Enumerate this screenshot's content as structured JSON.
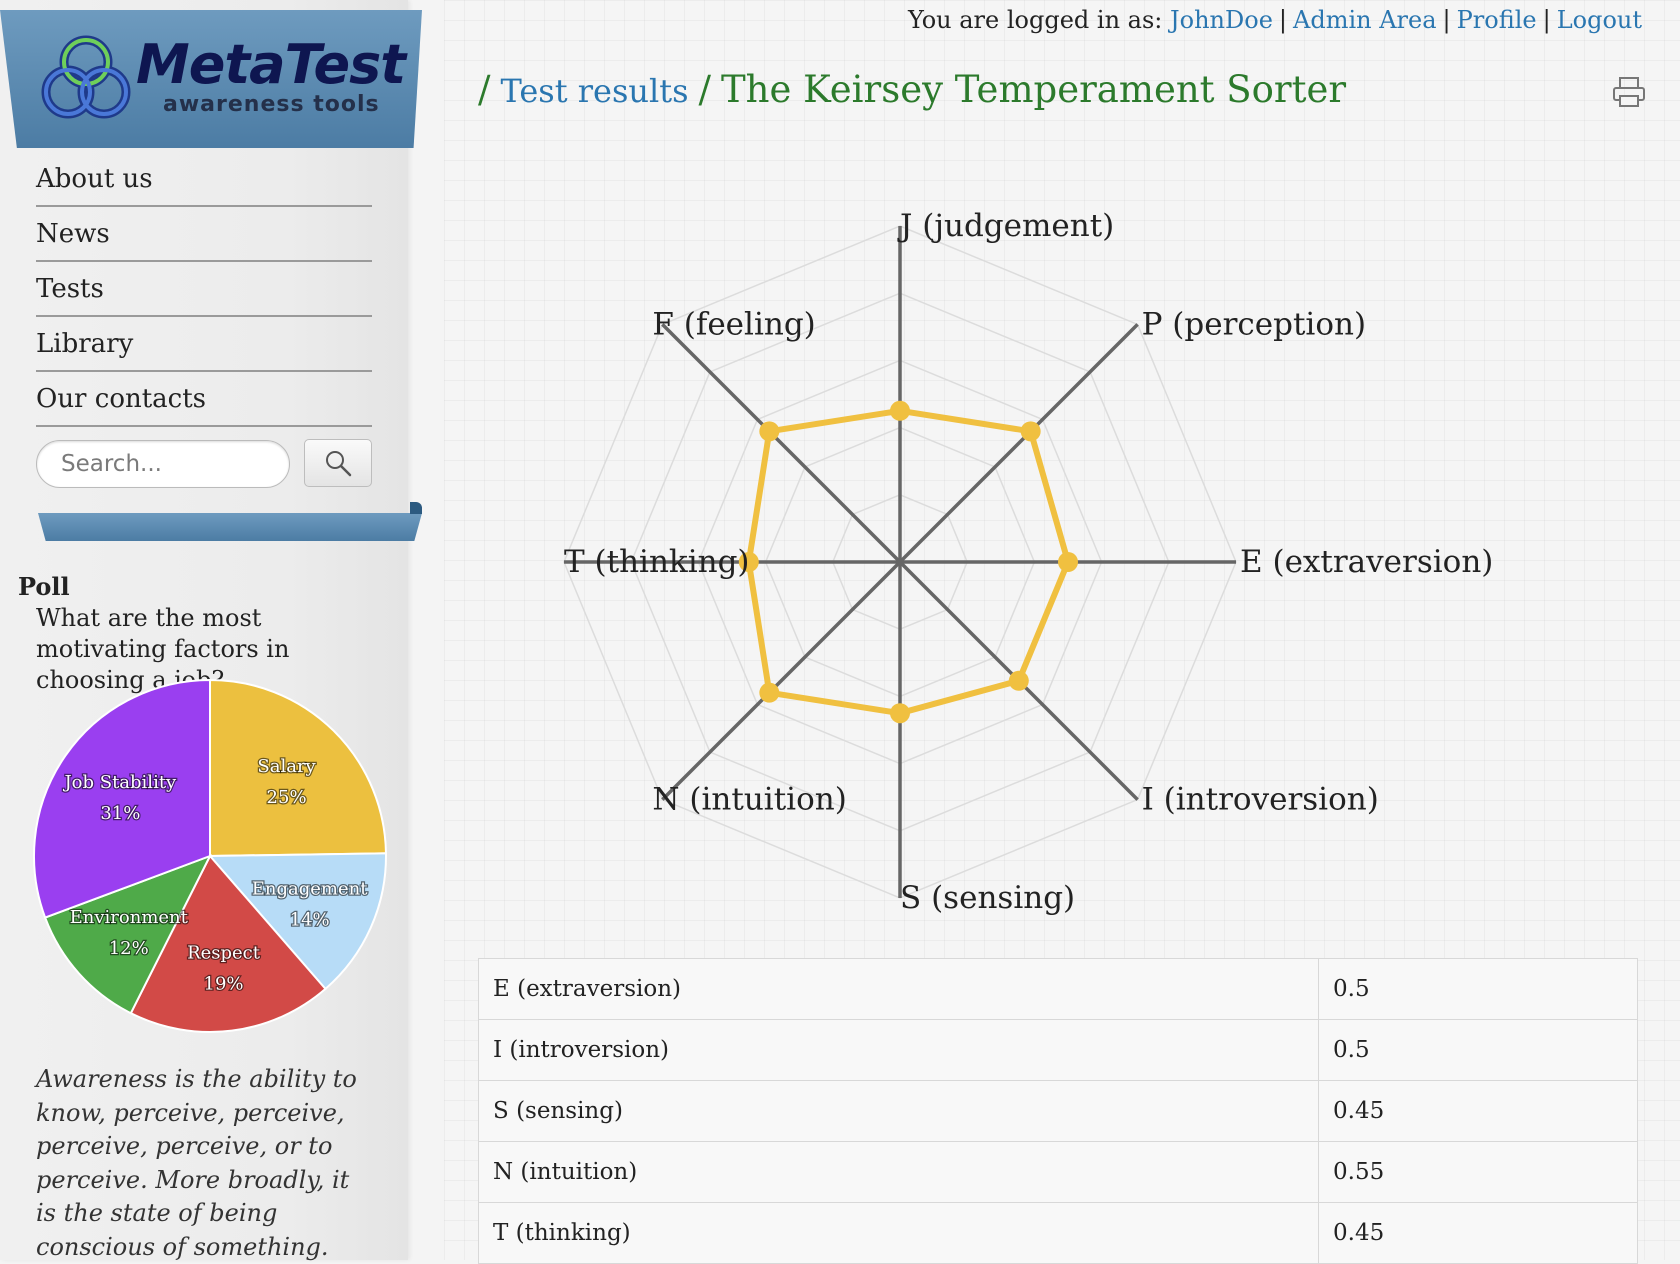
{
  "logo": {
    "title": "MetaTest",
    "subtitle": "awareness tools"
  },
  "nav": {
    "items": [
      {
        "label": "About us"
      },
      {
        "label": "News"
      },
      {
        "label": "Tests"
      },
      {
        "label": "Library"
      },
      {
        "label": "Our contacts"
      }
    ]
  },
  "search": {
    "placeholder": "Search...",
    "value": ""
  },
  "poll": {
    "heading": "Poll",
    "question": "What are the most motivating factors in choosing a job?",
    "slices": [
      {
        "label": "Salary",
        "percent": "25%",
        "value": 25,
        "color": "#ecc03f"
      },
      {
        "label": "Engagement",
        "percent": "14%",
        "value": 14,
        "color": "#b7dcf7"
      },
      {
        "label": "Respect",
        "percent": "19%",
        "value": 19,
        "color": "#d24a47"
      },
      {
        "label": "Environment",
        "percent": "12%",
        "value": 12,
        "color": "#4faa49"
      },
      {
        "label": "Job Stability",
        "percent": "31%",
        "value": 31,
        "color": "#9a3ff0"
      }
    ]
  },
  "quote": "Awareness is the ability to know, perceive, perceive, perceive, perceive, or to perceive. More broadly, it is the state of being conscious of something.",
  "userbar": {
    "prefix": "You are logged in as:",
    "user": "JohnDoe",
    "admin": "Admin Area",
    "profile": "Profile",
    "logout": "Logout"
  },
  "breadcrumb": {
    "link": "Test results",
    "current": "The Keirsey Temperament Sorter"
  },
  "chart_data": {
    "type": "radar",
    "axes": [
      "J (judgement)",
      "P (perception)",
      "E (extraversion)",
      "I (introversion)",
      "S (sensing)",
      "N (intuition)",
      "T (thinking)",
      "F (feeling)"
    ],
    "values": [
      0.45,
      0.55,
      0.5,
      0.5,
      0.45,
      0.55,
      0.45,
      0.55
    ],
    "range": [
      0,
      1
    ],
    "rings": 5,
    "series_color": "#f0c040"
  },
  "results": [
    {
      "trait": "E (extraversion)",
      "value": "0.5"
    },
    {
      "trait": "I (introversion)",
      "value": "0.5"
    },
    {
      "trait": "S (sensing)",
      "value": "0.45"
    },
    {
      "trait": "N (intuition)",
      "value": "0.55"
    },
    {
      "trait": "T (thinking)",
      "value": "0.45"
    }
  ]
}
